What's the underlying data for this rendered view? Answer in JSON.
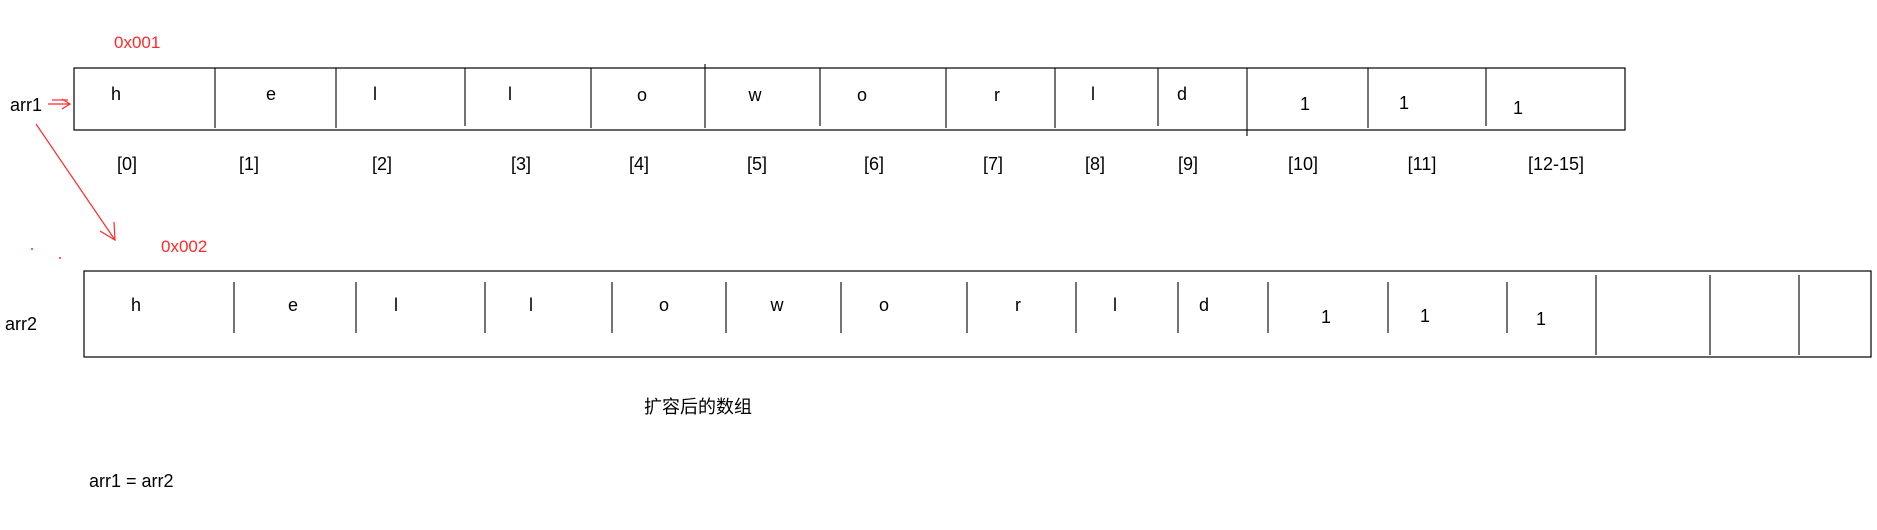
{
  "arr1": {
    "address": "0x001",
    "name": "arr1",
    "cells": [
      "h",
      "e",
      "l",
      "l",
      "o",
      "w",
      "o",
      "r",
      "l",
      "d",
      "1",
      "1",
      "1"
    ],
    "indices": [
      "[0]",
      "[1]",
      "[2]",
      "[3]",
      "[4]",
      "[5]",
      "[6]",
      "[7]",
      "[8]",
      "[9]",
      "[10]",
      "[11]",
      "[12-15]"
    ]
  },
  "arr2": {
    "address": "0x002",
    "name": "arr2",
    "cells": [
      "h",
      "e",
      "l",
      "l",
      "o",
      "w",
      "o",
      "r",
      "l",
      "d",
      "1",
      "1",
      "1",
      "",
      "",
      ""
    ]
  },
  "caption": "扩容后的数组",
  "assignment": "arr1 = arr2",
  "colors": {
    "annotation": "#ff2a2a",
    "ink": "#000000"
  }
}
